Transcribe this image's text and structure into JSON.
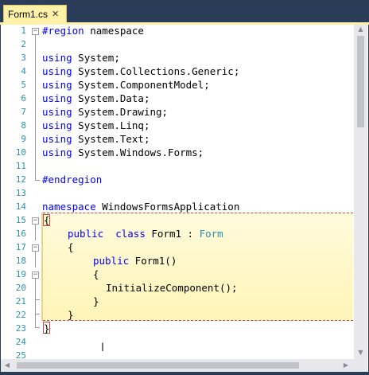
{
  "tab": {
    "label": "Form1.cs",
    "close_glyph": "✕"
  },
  "line_numbers": [
    "1",
    "2",
    "3",
    "4",
    "5",
    "6",
    "7",
    "8",
    "9",
    "10",
    "11",
    "12",
    "13",
    "14",
    "15",
    "16",
    "17",
    "18",
    "19",
    "20",
    "21",
    "22",
    "23",
    "24",
    "25"
  ],
  "code": {
    "l1": [
      "#region",
      " namespace"
    ],
    "l4": [
      "using",
      " System;"
    ],
    "l5": [
      "using",
      " System.Collections.Generic;"
    ],
    "l6": [
      "using",
      " System.ComponentModel;"
    ],
    "l7": [
      "using",
      " System.Data;"
    ],
    "l8": [
      "using",
      " System.Drawing;"
    ],
    "l9": [
      "using",
      " System.Linq;"
    ],
    "l10": [
      "using",
      " System.Text;"
    ],
    "l11": [
      "using",
      " System.Windows.Forms;"
    ],
    "l13": "#endregion",
    "l15": [
      "namespace",
      " WindowsFormsApplication"
    ],
    "l16": "{",
    "l17": [
      "public",
      "class",
      "Form1",
      " : ",
      "Form"
    ],
    "l18": "{",
    "l19": [
      "public",
      " Form1()"
    ],
    "l20": "{",
    "l21": "InitializeComponent();",
    "l22": "}",
    "l23": "}",
    "l24": "}"
  },
  "fold_glyph": "−",
  "scroll_up": "▲",
  "scroll_down": "▼",
  "scroll_left": "◀",
  "scroll_right": "▶",
  "cursor_glyph": "I",
  "colors": {
    "tab_active": "#fff1a8",
    "keyword": "#0000ff",
    "type": "#2b91af",
    "line_number": "#2b91af",
    "highlight": "#fff4b8",
    "highlight_border": "#c84848"
  }
}
